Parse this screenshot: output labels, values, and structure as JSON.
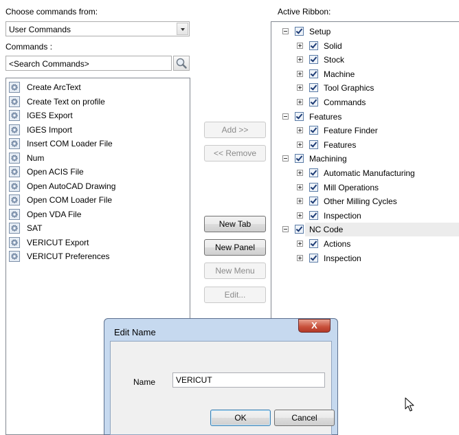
{
  "left_panel": {
    "choose_label": "Choose commands from:",
    "source_value": "User Commands",
    "commands_label": "Commands :",
    "search_placeholder": "<Search Commands>",
    "commands": [
      "Create ArcText",
      "Create Text on profile",
      "IGES Export",
      "IGES Import",
      "Insert COM Loader File",
      "Num",
      "Open ACIS File",
      "Open AutoCAD Drawing",
      "Open COM Loader File",
      "Open VDA File",
      "SAT",
      "VERICUT Export",
      "VERICUT Preferences"
    ]
  },
  "buttons": {
    "add": "Add >>",
    "remove": "<< Remove",
    "new_tab": "New Tab",
    "new_panel": "New Panel",
    "new_menu": "New Menu",
    "edit": "Edit..."
  },
  "ribbon": {
    "label": "Active Ribbon:",
    "tabs": [
      {
        "label": "Setup",
        "panels": [
          "Solid",
          "Stock",
          "Machine",
          "Tool Graphics",
          "Commands"
        ]
      },
      {
        "label": "Features",
        "panels": [
          "Feature Finder",
          "Features"
        ]
      },
      {
        "label": "Machining",
        "panels": [
          "Automatic Manufacturing",
          "Mill Operations",
          "Other Milling Cycles",
          "Inspection"
        ]
      },
      {
        "label": "NC Code",
        "panels": [
          "Actions",
          "Inspection"
        ]
      }
    ],
    "selected_tab": "NC Code"
  },
  "dialog": {
    "title": "Edit Name",
    "close_glyph": "X",
    "name_label": "Name",
    "name_value": "VERICUT",
    "ok": "OK",
    "cancel": "Cancel"
  },
  "icons": {
    "command": "gear-icon",
    "search": "magnifier-icon",
    "expand": "tree-expander-icon",
    "check": "checkbox-checked-icon",
    "pointer": "mouse-pointer-icon"
  }
}
